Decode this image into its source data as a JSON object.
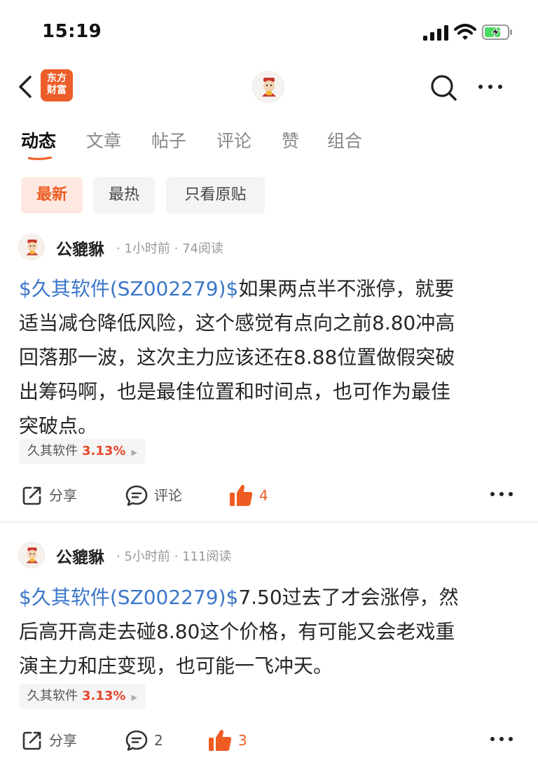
{
  "status_bar": {
    "time": "15:19"
  },
  "nav": {
    "logo_line1": "东方",
    "logo_line2": "财富"
  },
  "tabs": [
    {
      "label": "动态",
      "active": true
    },
    {
      "label": "文章",
      "active": false
    },
    {
      "label": "帖子",
      "active": false
    },
    {
      "label": "评论",
      "active": false
    },
    {
      "label": "赞",
      "active": false
    },
    {
      "label": "组合",
      "active": false
    }
  ],
  "filters": [
    {
      "label": "最新",
      "active": true
    },
    {
      "label": "最热",
      "active": false
    },
    {
      "label": "只看原贴",
      "active": false
    }
  ],
  "posts": [
    {
      "author": "公貔貅",
      "time": "1小时前",
      "reads": "74阅读",
      "stock_link": "$久其软件(SZ002279)$",
      "lines": [
        "如果两点半不涨停，就要",
        "适当减仓降低风险，这个感觉有点向之前8.80冲高",
        "回落那一波，这次主力应该还在8.88位置做假突破",
        "出筹码啊，也是最佳位置和时间点，也可作为最佳",
        "突破点。"
      ],
      "tag_name": "久其软件",
      "tag_change": "3.13%",
      "share_label": "分享",
      "comment_label": "评论",
      "like_count": "4"
    },
    {
      "author": "公貔貅",
      "time": "5小时前",
      "reads": "111阅读",
      "stock_link": "$久其软件(SZ002279)$",
      "lines": [
        "7.50过去了才会涨停，然",
        "后高开高走去碰8.80这个价格，有可能又会老戏重",
        "演主力和庄变现，也可能一飞冲天。"
      ],
      "tag_name": "久其软件",
      "tag_change": "3.13%",
      "share_label": "分享",
      "comment_label": "2",
      "like_count": "3"
    }
  ],
  "colors": {
    "accent": "#ee5c23",
    "stock_link": "#3a76c9",
    "rise": "#e6452c"
  },
  "icons": {
    "back": "chevron-left-icon",
    "search": "search-icon",
    "more": "more-icon",
    "share": "share-icon",
    "comment": "comment-icon",
    "like": "thumbs-up-icon"
  }
}
